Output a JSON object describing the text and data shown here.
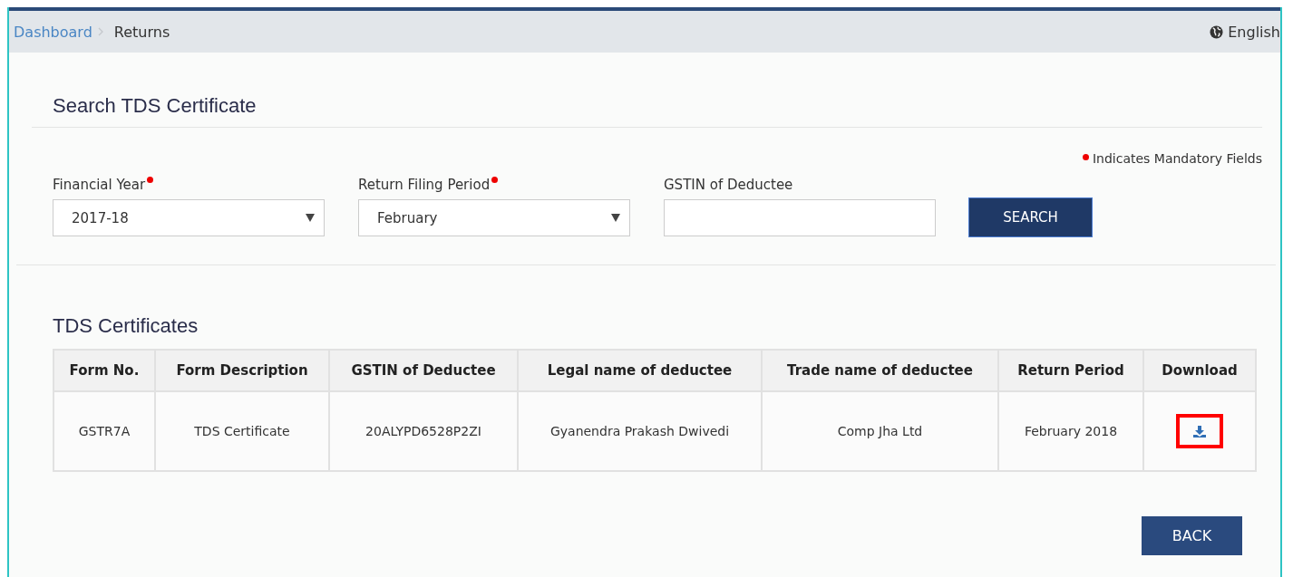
{
  "breadcrumb": [
    {
      "label": "Dashboard",
      "link": true
    },
    {
      "label": "Returns",
      "link": false
    }
  ],
  "language": {
    "label": "English"
  },
  "search_section": {
    "title": "Search TDS Certificate",
    "mandatory_note": "Indicates Mandatory Fields",
    "fields": [
      {
        "kind": "select",
        "label": "Financial Year",
        "required": true,
        "value": "2017-18"
      },
      {
        "kind": "select",
        "label": "Return Filing Period",
        "required": true,
        "value": "February"
      },
      {
        "kind": "text",
        "label": "GSTIN of Deductee",
        "required": false
      }
    ],
    "search_button": "SEARCH"
  },
  "certificates": {
    "title": "TDS Certificates",
    "columns": [
      "Form No.",
      "Form Description",
      "GSTIN of Deductee",
      "Legal name of deductee",
      "Trade name of deductee",
      "Return Period",
      "Download"
    ],
    "rows": [
      {
        "cells": [
          "GSTR7A",
          "TDS Certificate",
          "20ALYPD6528P2ZI",
          "Gyanendra Prakash Dwivedi",
          "Comp Jha Ltd",
          "February 2018"
        ],
        "download_highlighted": true
      }
    ]
  },
  "back_button": "BACK"
}
